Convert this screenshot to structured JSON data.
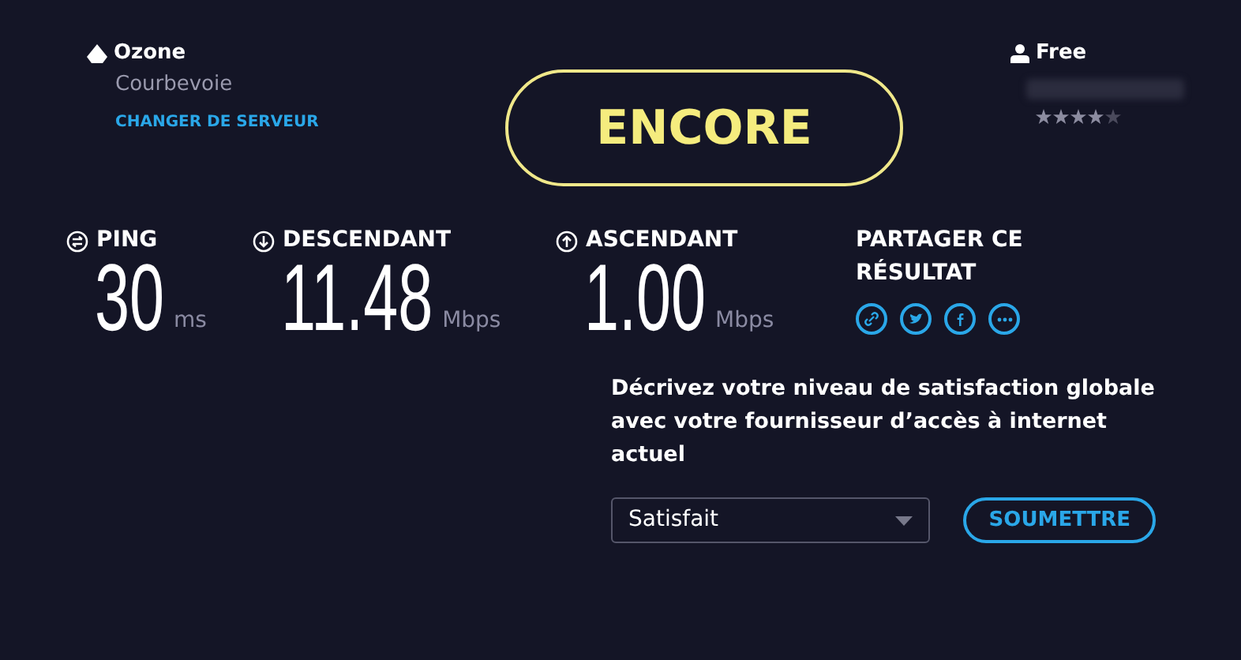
{
  "server": {
    "name": "Ozone",
    "city": "Courbevoie",
    "change_link": "CHANGER DE SERVEUR"
  },
  "again_button": "ENCORE",
  "provider": {
    "name": "Free",
    "stars": 4
  },
  "metrics": [
    {
      "kind": "ping",
      "label": "PING",
      "value": "30",
      "unit": "ms"
    },
    {
      "kind": "download",
      "label": "DESCENDANT",
      "value": "11.48",
      "unit": "Mbps"
    },
    {
      "kind": "upload",
      "label": "ASCENDANT",
      "value": "1.00",
      "unit": "Mbps"
    }
  ],
  "share": {
    "title": "PARTAGER CE RÉSULTAT",
    "buttons": [
      {
        "kind": "link"
      },
      {
        "kind": "twitter"
      },
      {
        "kind": "facebook"
      },
      {
        "kind": "more"
      }
    ]
  },
  "survey": {
    "question": "Décrivez votre niveau de satisfaction globale avec votre fournisseur d’accès à internet actuel",
    "value": "Satisfait",
    "submit": "SOUMETTRE"
  }
}
